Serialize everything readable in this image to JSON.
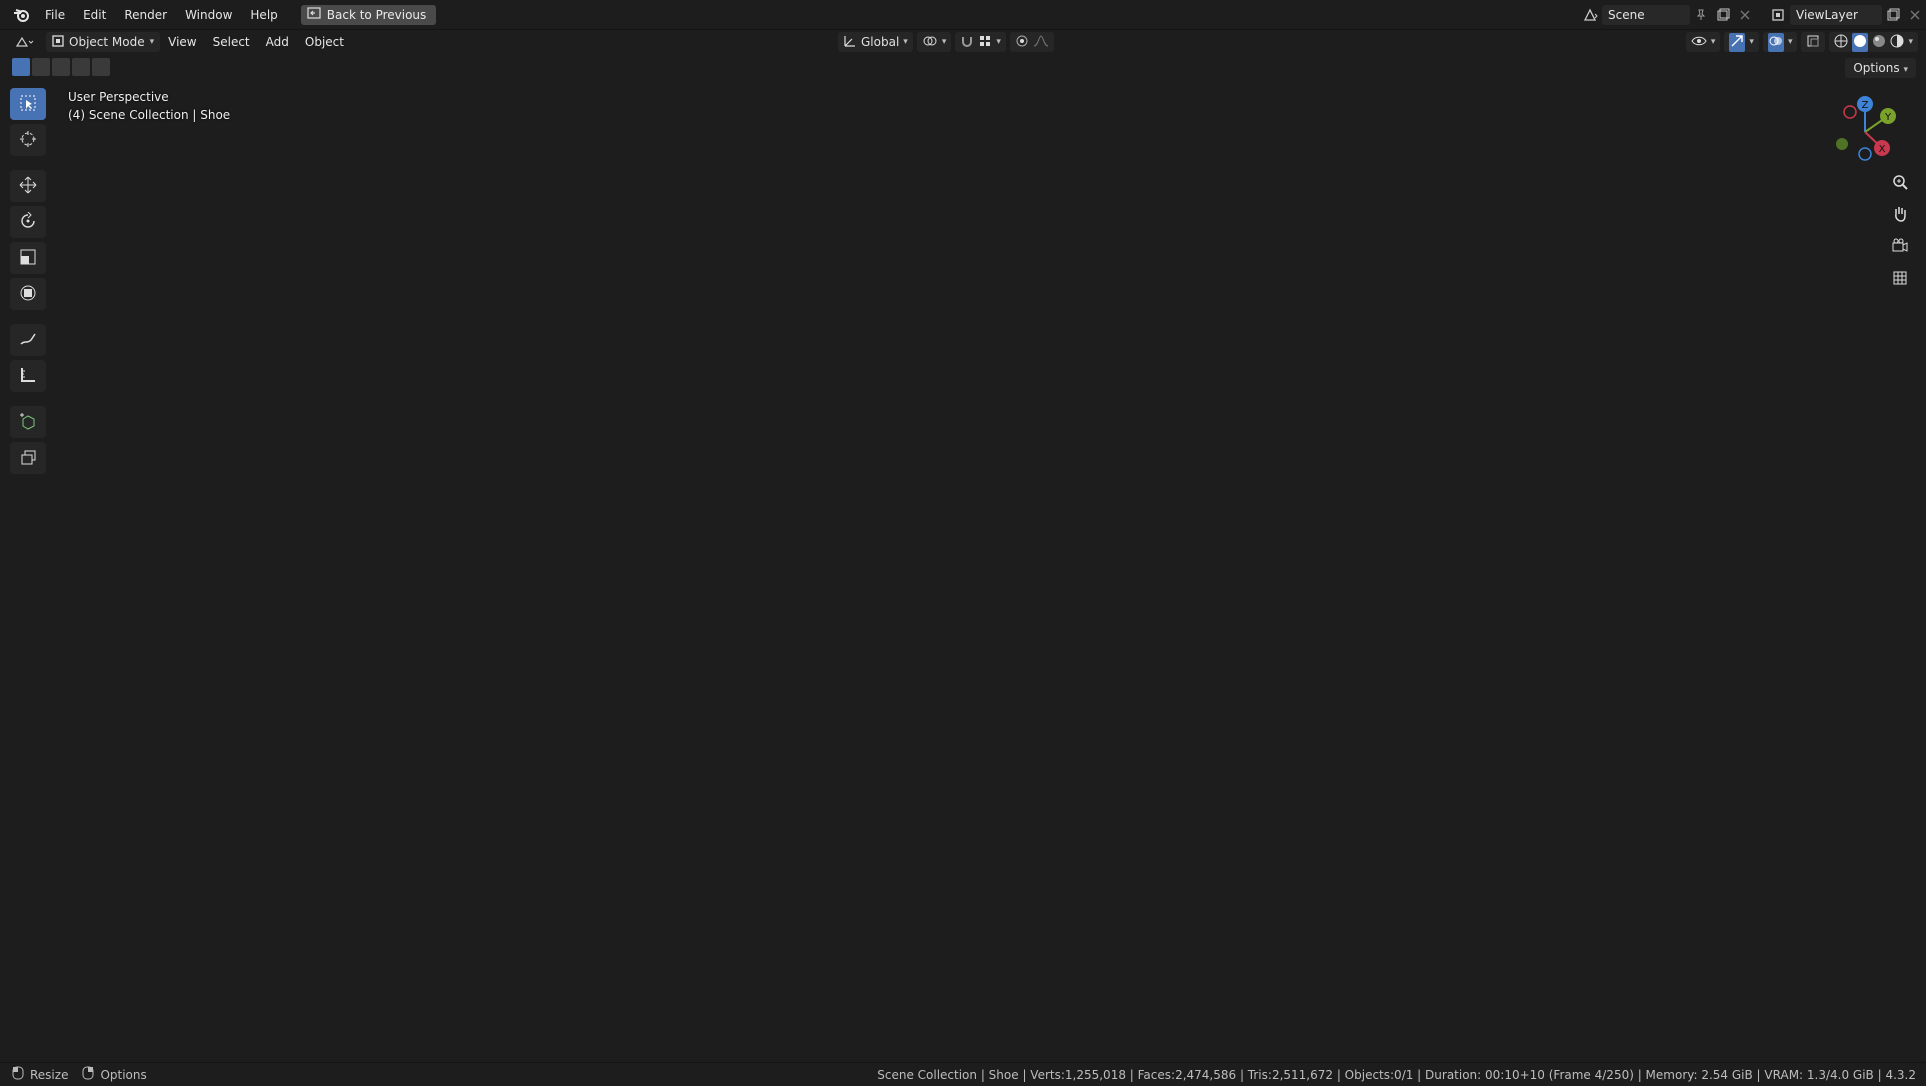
{
  "topbar": {
    "menus": [
      "File",
      "Edit",
      "Render",
      "Window",
      "Help"
    ],
    "back_button": "Back to Previous",
    "scene_field": "Scene",
    "viewlayer_field": "ViewLayer"
  },
  "viewport_header": {
    "mode": "Object Mode",
    "menus": [
      "View",
      "Select",
      "Add",
      "Object"
    ],
    "transform_orientation": "Global",
    "options_label": "Options"
  },
  "viewport": {
    "perspective_label": "User Perspective",
    "collection_label": "(4) Scene Collection | Shoe"
  },
  "gizmo": {
    "x_label": "X",
    "y_label": "Y",
    "z_label": "Z"
  },
  "statusbar": {
    "resize_label": "Resize",
    "options_label": "Options",
    "stats": "Scene Collection | Shoe | Verts:1,255,018 | Faces:2,474,586 | Tris:2,511,672 | Objects:0/1 | Duration: 00:10+10 (Frame 4/250) | Memory: 2.54 GiB | VRAM: 1.3/4.0 GiB | 4.3.2"
  },
  "colors": {
    "accent": "#4772b3",
    "axis_x": "#c8384e",
    "axis_y": "#7aa12a",
    "axis_z": "#3f83d8"
  }
}
